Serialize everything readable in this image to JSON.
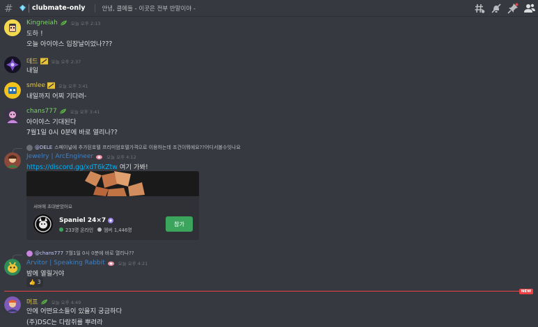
{
  "header": {
    "title": "clubmate-only",
    "topic": "안녕, 클메들 - 이곳은 전부 반말이야 -"
  },
  "colors": {
    "bg": "#36393f",
    "accent_green": "#3ba55d",
    "new_red": "#ed4245",
    "link": "#00aff4"
  },
  "messages": [
    {
      "user": "Kingneiah",
      "color": "#7dd36b",
      "time": "오늘 오후 2:13",
      "badge": "leaf-badge-icon",
      "lines": [
        "도하 !",
        "오늘 아이야스 입장날이었나???"
      ]
    },
    {
      "user": "데드",
      "color": "#e3c64f",
      "time": "오늘 오후 2:37",
      "badge": "boost-badge-icon",
      "lines": [
        "내일"
      ]
    },
    {
      "user": "smlee",
      "color": "#e3c64f",
      "time": "오늘 오후 3:41",
      "badge": "boost-badge-icon",
      "lines": [
        "내일까지 어찌 기다려-"
      ]
    },
    {
      "user": "chans777",
      "color": "#7dd36b",
      "time": "오늘 오후 3:41",
      "badge": "leaf-badge-icon",
      "lines": [
        "아이야스 기대된다",
        "7월1일 0시 0분에 바로 열리나??"
      ]
    },
    {
      "reply_to": "@DELE",
      "reply_text": "스페이널에 추가된호텔 프리미엄호텔가격으로 이용하는데 조건이뭐에요??어디서볼수잇나요",
      "user": "Jewelry | ArcEngineer",
      "color": "#3e82c8",
      "time": "오늘 오후 4:12",
      "link": "https://discord.gg/xdT6kZtw",
      "after_link": " 여기 가봐!",
      "invite": {
        "heading": "서버에 초대받았어요",
        "server": "Spaniel 24×7",
        "online": "233명 온라인",
        "members": "멤버 1,446명",
        "join": "참가"
      }
    },
    {
      "reply_to": "@chans777",
      "reply_text": "7월1일 0시 0분에 바로 열리나??",
      "user": "Arvitor | Speaking Rabbit",
      "color": "#3e82c8",
      "time": "오늘 오후 4:21",
      "lines": [
        "밤에 열릴거야"
      ],
      "reaction": {
        "emoji": "👍",
        "count": "3"
      }
    },
    {
      "user": "머프",
      "color": "#e3c64f",
      "time": "오늘 오후 4:49",
      "badge": "leaf-badge-icon",
      "lines": [
        "안에 어떤요소들이 있을지 궁금하다",
        "(주)DSC는 다람쥐를 뿌려라"
      ]
    }
  ],
  "new_label": "NEW"
}
